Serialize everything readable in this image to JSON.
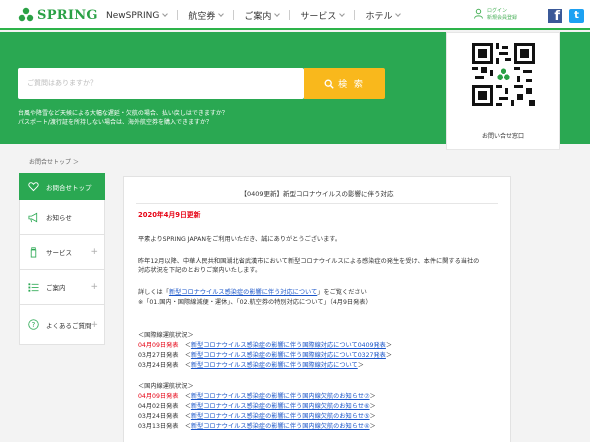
{
  "header": {
    "logo_text": "SPRING",
    "nav": [
      {
        "label": "NewSPRING",
        "has_chevron": true
      },
      {
        "label": "航空券",
        "has_chevron": true
      },
      {
        "label": "ご案内",
        "has_chevron": true
      },
      {
        "label": "サービス",
        "has_chevron": true
      },
      {
        "label": "ホテル",
        "has_chevron": true
      }
    ],
    "login_label": "ログイン",
    "register_label": "新規会員登録",
    "facebook_glyph": "f",
    "twitter_glyph": "t"
  },
  "hero": {
    "search_placeholder": "ご質問はありますか？",
    "search_button": "検 索",
    "notice_line1": "台風や降雪など天候による大幅な遅延・欠航の場合、払い戻しはできますか？",
    "notice_line2": "パスポート/渡行証を所持しない場合は、海外航空券を購入できますか？"
  },
  "qr": {
    "caption": "お問い合せ窓口"
  },
  "breadcrumb": {
    "text": "お問合せトップ ＞"
  },
  "sidebar": {
    "items": [
      {
        "label": "お問合せトップ",
        "icon": "heart-icon",
        "active": true,
        "plus": false
      },
      {
        "label": "お知らせ",
        "icon": "megaphone-icon",
        "active": false,
        "plus": false
      },
      {
        "label": "サービス",
        "icon": "bottle-icon",
        "active": false,
        "plus": true
      },
      {
        "label": "ご案内",
        "icon": "list-icon",
        "active": false,
        "plus": true
      },
      {
        "label": "よくあるご質問",
        "icon": "question-icon",
        "active": false,
        "plus": true
      }
    ]
  },
  "article": {
    "title": "【0409更新】新型コロナウイルスの影響に伴う対応",
    "date_heading": "2020年4月9日更新",
    "greeting": "平素よりSPRING JAPANをご利用いただき、誠にありがとうございます。",
    "para1_line1": "昨年12月以降、中華人民共和国湖北省武漢市において新型コロナウイルスによる感染症の発生を受け、本件に関する当社の",
    "para1_line2": "対応状況を下記のとおりご案内いたします。",
    "details_prefix": "詳しくは「",
    "details_link": "新型コロナウイルス感染症の影響に伴う対応について",
    "details_suffix": "」をご覧ください",
    "note": "※「01.国内・国際線減便・運休」、「02.航空券の特別対応について」（4月9日発表）",
    "intl_heading": "＜国際線運航状況＞",
    "intl_rows": [
      {
        "date": "04月09日発表",
        "link": "新型コロナウイルス感染症の影響に伴う国際線対応について0409発表",
        "highlight": true
      },
      {
        "date": "03月27日発表",
        "link": "新型コロナウイルス感染症の影響に伴う国際線対応について0327発表",
        "highlight": false
      },
      {
        "date": "03月24日発表",
        "link": "新型コロナウイルス感染症の影響に伴う国際線対応について",
        "highlight": false
      }
    ],
    "dom_heading": "＜国内線運航状況＞",
    "dom_rows": [
      {
        "date": "04月09日発表",
        "link": "新型コロナウイルス感染症の影響に伴う国内線欠航のお知らせ⑦",
        "highlight": true
      },
      {
        "date": "04月02日発表",
        "link": "新型コロナウイルス感染症の影響に伴う国内線欠航のお知らせ⑥",
        "highlight": false
      },
      {
        "date": "03月24日発表",
        "link": "新型コロナウイルス感染症の影響に伴う国内線欠航のお知らせ⑤",
        "highlight": false
      },
      {
        "date": "03月13日発表",
        "link": "新型コロナウイルス感染症の影響に伴う国内線欠航のお知らせ④",
        "highlight": false
      }
    ],
    "row_open": "＜",
    "row_close": "＞"
  },
  "colors": {
    "brand_green": "#2aa852",
    "search_yellow": "#f9b81c",
    "alert_red": "#e60012",
    "link_blue": "#1a55c8"
  }
}
